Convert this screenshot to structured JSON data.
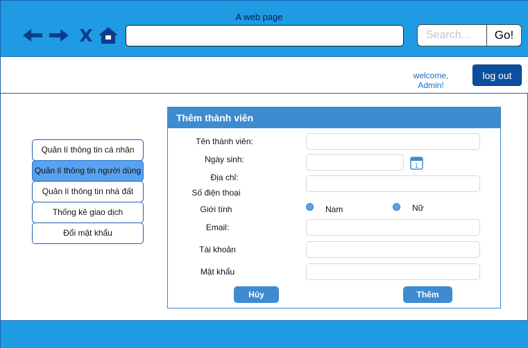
{
  "browser": {
    "page_title": "A web page",
    "url": "",
    "search_placeholder": "Search...",
    "go_label": "Go!",
    "icons": [
      "back-arrow-icon",
      "forward-arrow-icon",
      "close-icon",
      "home-icon"
    ]
  },
  "header": {
    "welcome_line1": "welcome,",
    "welcome_line2": "Admin!",
    "logout_label": "log out"
  },
  "sidebar": {
    "items": [
      {
        "label": "Quản lí thông tin cá nhân",
        "active": false
      },
      {
        "label": "Quản lí thông tin người dùng",
        "active": true
      },
      {
        "label": "Quản lí thông tin nhà đất",
        "active": false
      },
      {
        "label": "Thống kê giao dịch",
        "active": false
      },
      {
        "label": "Đổi mật khẩu",
        "active": false
      }
    ]
  },
  "form": {
    "title": "Thêm thành viên",
    "labels": {
      "name": "Tên thành viên:",
      "birthday": "Ngày sinh:",
      "address": "Địa chỉ:",
      "phone": "Số điện thoại",
      "gender": "Giới tính",
      "email": "Email:",
      "account": "Tài khoản",
      "password": "Mật khẩu"
    },
    "values": {
      "name": "",
      "birthday": "",
      "address": "",
      "email": "",
      "account": "",
      "password": ""
    },
    "calendar_day": "1",
    "gender_options": [
      "Nam",
      "Nữ"
    ],
    "cancel_label": "Hủy",
    "submit_label": "Thêm"
  },
  "colors": {
    "chrome_blue": "#1e9be3",
    "panel_blue": "#3f8bd0",
    "active_item": "#5aa2ef",
    "logout_blue": "#0b4f9e"
  }
}
